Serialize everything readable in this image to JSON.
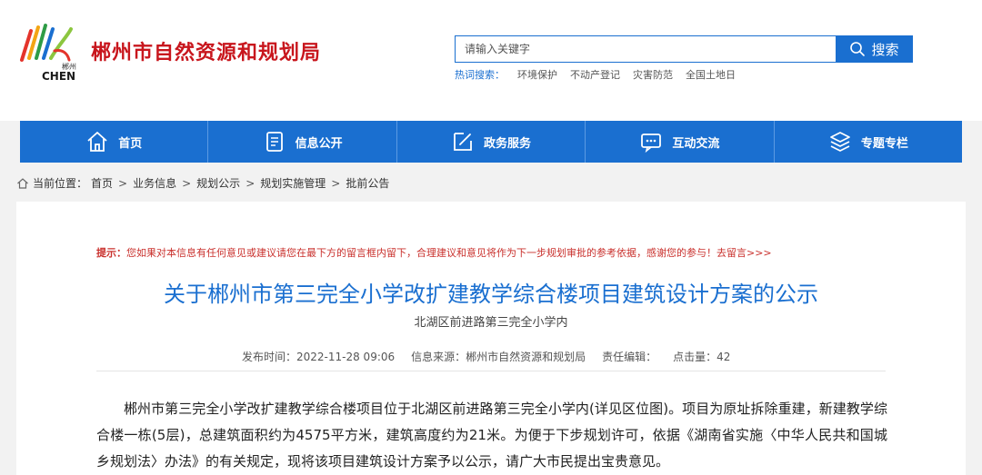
{
  "header": {
    "logo_text_cn": "郴州",
    "logo_text_en": "CHEN",
    "site_title": "郴州市自然资源和规划局"
  },
  "search": {
    "placeholder": "请输入关键字",
    "button_label": "搜索"
  },
  "hot_search": {
    "label": "热词搜索：",
    "items": [
      "环境保护",
      "不动产登记",
      "灾害防范",
      "全国土地日"
    ]
  },
  "nav": {
    "items": [
      {
        "label": "首页",
        "icon": "home-icon"
      },
      {
        "label": "信息公开",
        "icon": "document-icon"
      },
      {
        "label": "政务服务",
        "icon": "edit-icon"
      },
      {
        "label": "互动交流",
        "icon": "chat-icon"
      },
      {
        "label": "专题专栏",
        "icon": "layers-icon"
      }
    ]
  },
  "breadcrumb": {
    "label": "当前位置：",
    "items": [
      "首页",
      "业务信息",
      "规划公示",
      "规划实施管理",
      "批前公告"
    ],
    "separator": ">"
  },
  "article": {
    "tip_label": "提示：",
    "tip_text": "您如果对本信息有任何意见或建议请您在最下方的留言框内留下，合理建议和意见将作为下一步规划审批的参考依据，感谢您的参与！",
    "tip_link": "去留言>>>",
    "title": "关于郴州市第三完全小学改扩建教学综合楼项目建筑设计方案的公示",
    "subtitle": "北湖区前进路第三完全小学内",
    "meta": {
      "publish_time": "发布时间：2022-11-28 09:06",
      "source": "信息来源：郴州市自然资源和规划局",
      "editor": "责任编辑：",
      "clicks": "点击量：42"
    },
    "body": "郴州市第三完全小学改扩建教学综合楼项目位于北湖区前进路第三完全小学内(详见区位图)。项目为原址拆除重建，新建教学综合楼一栋(5层)，总建筑面积约为4575平方米，建筑高度约为21米。为便于下步规划许可，依据《湖南省实施〈中华人民共和国城乡规划法〉办法》的有关规定，现将该项目建筑设计方案予以公示，请广大市民提出宝贵意见。"
  },
  "colors": {
    "brand_blue": "#1a6fd0",
    "title_red": "#c8161d",
    "tip_red": "#c9302c"
  }
}
